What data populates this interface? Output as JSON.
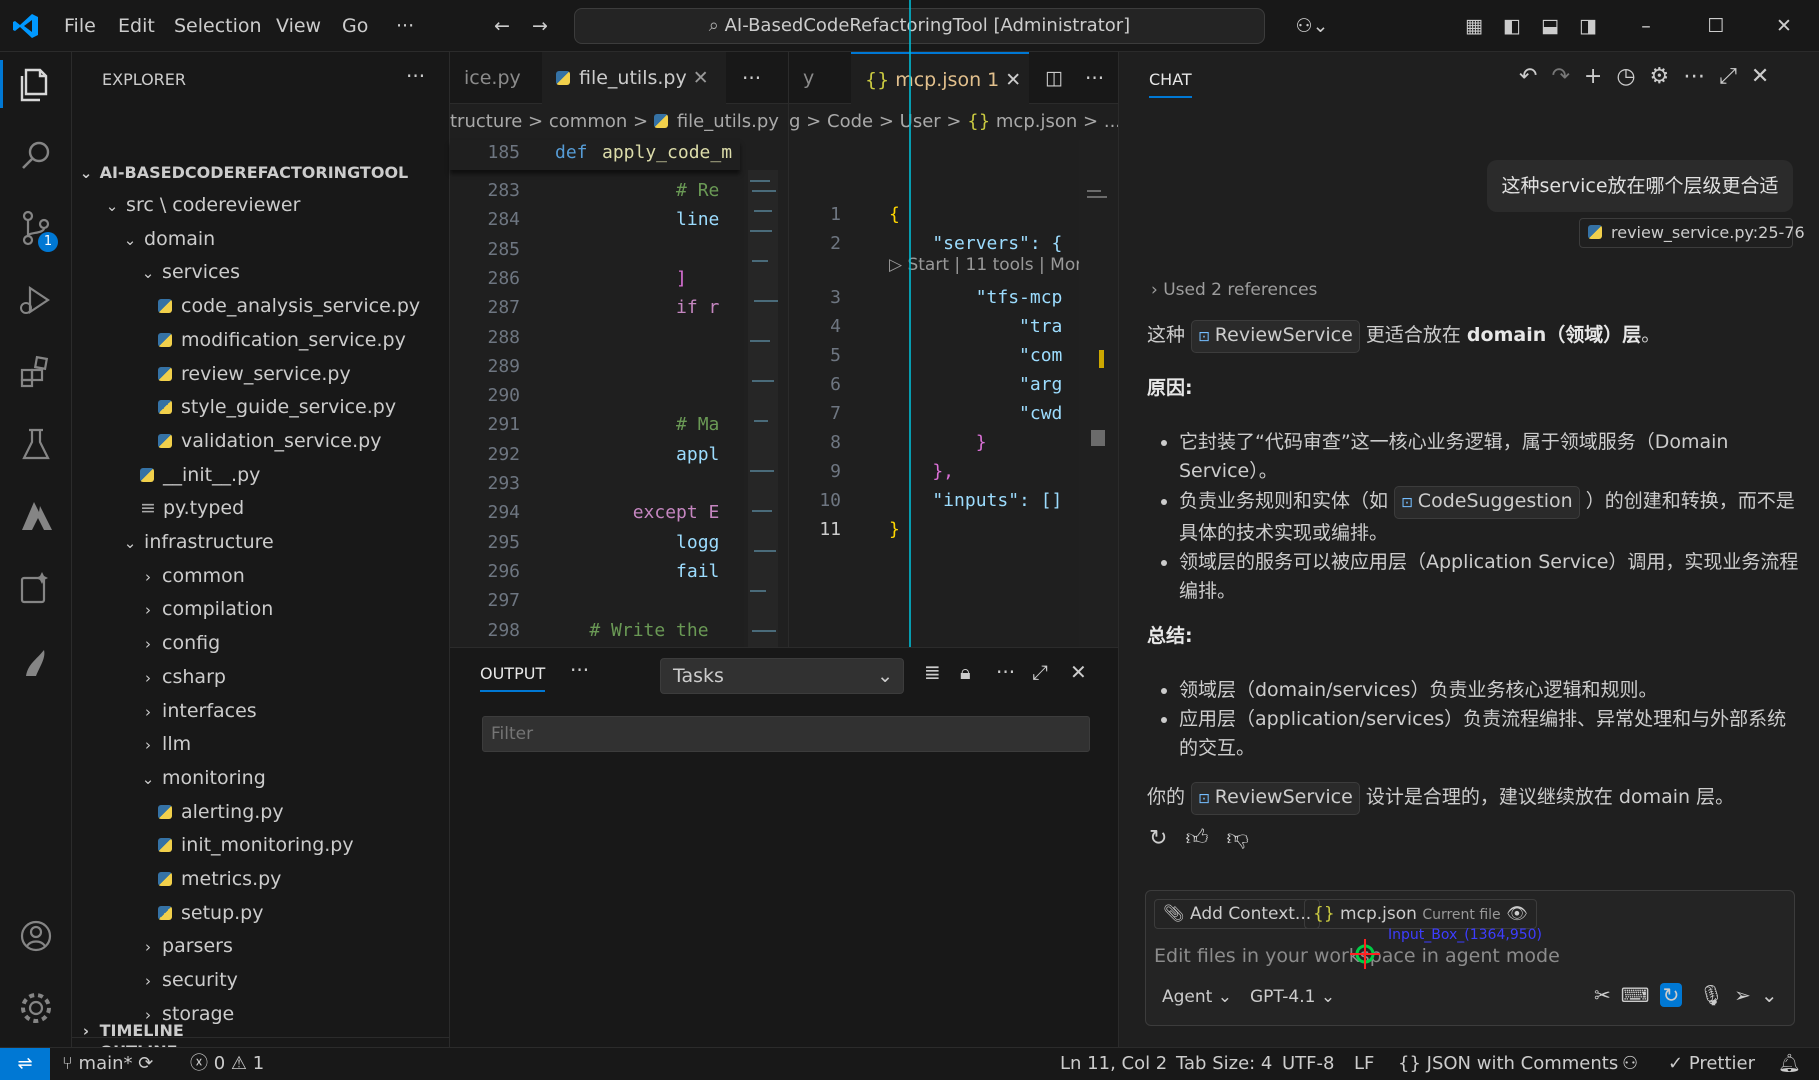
{
  "menu": {
    "file": "File",
    "edit": "Edit",
    "selection": "Selection",
    "view": "View",
    "go": "Go",
    "more": "···"
  },
  "command_center": {
    "text": "AI-BasedCodeRefactoringTool [Administrator]"
  },
  "activity": {
    "scm_badge": "1"
  },
  "explorer": {
    "title": "EXPLORER",
    "root": "AI-BASEDCODEREFACTORINGTOOL",
    "items": [
      {
        "label": "src \\ codereviewer",
        "type": "folder-open",
        "indent": 1
      },
      {
        "label": "domain",
        "type": "folder-open",
        "indent": 2
      },
      {
        "label": "services",
        "type": "folder-open",
        "indent": 3
      },
      {
        "label": "code_analysis_service.py",
        "type": "py",
        "indent": 4
      },
      {
        "label": "modification_service.py",
        "type": "py",
        "indent": 4
      },
      {
        "label": "review_service.py",
        "type": "py",
        "indent": 4
      },
      {
        "label": "style_guide_service.py",
        "type": "py",
        "indent": 4
      },
      {
        "label": "validation_service.py",
        "type": "py",
        "indent": 4
      },
      {
        "label": "__init__.py",
        "type": "py",
        "indent": 3
      },
      {
        "label": "py.typed",
        "type": "txt",
        "indent": 3
      },
      {
        "label": "infrastructure",
        "type": "folder-open",
        "indent": 2
      },
      {
        "label": "common",
        "type": "folder",
        "indent": 3
      },
      {
        "label": "compilation",
        "type": "folder",
        "indent": 3
      },
      {
        "label": "config",
        "type": "folder",
        "indent": 3
      },
      {
        "label": "csharp",
        "type": "folder",
        "indent": 3
      },
      {
        "label": "interfaces",
        "type": "folder",
        "indent": 3
      },
      {
        "label": "llm",
        "type": "folder",
        "indent": 3
      },
      {
        "label": "monitoring",
        "type": "folder-open",
        "indent": 3
      },
      {
        "label": "alerting.py",
        "type": "py",
        "indent": 4
      },
      {
        "label": "init_monitoring.py",
        "type": "py",
        "indent": 4
      },
      {
        "label": "metrics.py",
        "type": "py",
        "indent": 4
      },
      {
        "label": "setup.py",
        "type": "py",
        "indent": 4
      },
      {
        "label": "parsers",
        "type": "folder",
        "indent": 3
      },
      {
        "label": "security",
        "type": "folder",
        "indent": 3
      },
      {
        "label": "storage",
        "type": "folder",
        "indent": 3
      }
    ],
    "outline": "OUTLINE",
    "timeline": "TIMELINE"
  },
  "editor1": {
    "tabs": [
      {
        "label": "ice.py"
      },
      {
        "label": "file_utils.py"
      }
    ],
    "breadcrumb": [
      "tructure",
      ">",
      "common",
      ">",
      "file_utils.py"
    ],
    "sticky_line": {
      "num": "185",
      "kw": "def",
      "name": "apply_code_m"
    },
    "lines": [
      {
        "n": "283",
        "t": "            # Re",
        "c": "comment"
      },
      {
        "n": "284",
        "t": "            line",
        "c": "var"
      },
      {
        "n": "285",
        "t": "",
        "c": "var"
      },
      {
        "n": "286",
        "t": "            ]",
        "c": "bracket"
      },
      {
        "n": "287",
        "t": "            if r",
        "c": "kw"
      },
      {
        "n": "288",
        "t": "",
        "c": "var"
      },
      {
        "n": "289",
        "t": "",
        "c": "var"
      },
      {
        "n": "290",
        "t": "",
        "c": "var"
      },
      {
        "n": "291",
        "t": "            # Ma",
        "c": "comment"
      },
      {
        "n": "292",
        "t": "            appl",
        "c": "var"
      },
      {
        "n": "293",
        "t": "",
        "c": "var"
      },
      {
        "n": "294",
        "t": "        except E",
        "c": "kw"
      },
      {
        "n": "295",
        "t": "            logg",
        "c": "var"
      },
      {
        "n": "296",
        "t": "            fail",
        "c": "var"
      },
      {
        "n": "297",
        "t": "",
        "c": "var"
      },
      {
        "n": "298",
        "t": "    # Write the",
        "c": "comment"
      }
    ]
  },
  "editor2": {
    "tabs": [
      {
        "label": "y"
      },
      {
        "label": "mcp.json 1"
      }
    ],
    "breadcrumb": [
      "g",
      ">",
      "Code",
      ">",
      "User",
      ">",
      "{}",
      "mcp.json",
      ">",
      "..."
    ],
    "codelens": "▷ Start | 11 tools | More...",
    "lines": [
      {
        "n": "1",
        "t": "{"
      },
      {
        "n": "2",
        "t": "    \"servers\": {"
      },
      {
        "n": "3",
        "t": "        \"tfs-mcp"
      },
      {
        "n": "4",
        "t": "            \"tra"
      },
      {
        "n": "5",
        "t": "            \"com"
      },
      {
        "n": "6",
        "t": "            \"arg"
      },
      {
        "n": "7",
        "t": "            \"cwd"
      },
      {
        "n": "8",
        "t": "        }"
      },
      {
        "n": "9",
        "t": "    },"
      },
      {
        "n": "10",
        "t": "    \"inputs\": []"
      },
      {
        "n": "11",
        "t": "}"
      }
    ]
  },
  "panel": {
    "tab": "OUTPUT",
    "dropdown": "Tasks",
    "filter_placeholder": "Filter"
  },
  "chat": {
    "title": "CHAT",
    "user_message": "这种service放在哪个层级更合适",
    "attachment": "review_service.py:25-76",
    "references": "Used 2 references",
    "p1_pre": "这种",
    "p1_chip": "ReviewService",
    "p1_mid": "更适合放在",
    "p1_bold": "domain（领域）层",
    "p1_post": "。",
    "h_reason": "原因:",
    "b1": "它封装了“代码审查”这一核心业务逻辑，属于领域服务（Domain Service）。",
    "b2_pre": "负责业务规则和实体（如",
    "b2_chip": "CodeSuggestion",
    "b2_post": "）的创建和转换，而不是具体的技术实现或编排。",
    "b3": "领域层的服务可以被应用层（Application Service）调用，实现业务流程编排。",
    "h_summary": "总结:",
    "s1": "领域层（domain/services）负责业务核心逻辑和规则。",
    "s2": "应用层（application/services）负责流程编排、异常处理和与外部系统的交互。",
    "p_last_pre": "你的",
    "p_last_chip": "ReviewService",
    "p_last_post": "设计是合理的，建议继续放在 domain 层。",
    "add_context": "Add Context...",
    "file_chip": "mcp.json",
    "file_chip_sub": "Current file",
    "input_placeholder": "Edit files in your workspace in agent mode",
    "overlay_label": "Input_Box_(1364,950)",
    "mode": "Agent",
    "model": "GPT-4.1"
  },
  "status": {
    "branch": "main*",
    "errors": "0",
    "warnings": "1",
    "cursor": "Ln 11, Col 2",
    "tab_size": "Tab Size: 4",
    "encoding": "UTF-8",
    "eol": "LF",
    "language": "JSON with Comments",
    "prettier": "Prettier"
  },
  "colors": {
    "accent": "#0078d4",
    "badge": "#0078d4",
    "folder_line": "#00bcd4"
  }
}
